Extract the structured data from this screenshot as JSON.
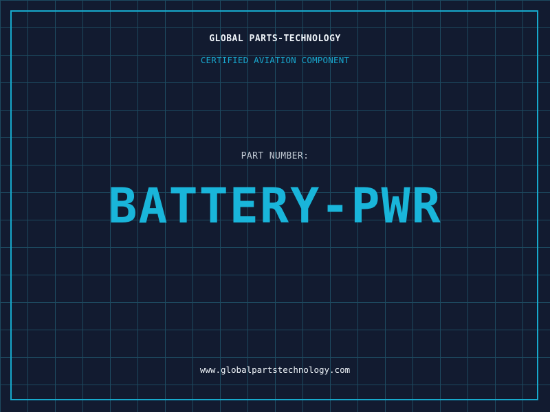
{
  "header": {
    "company_name": "GLOBAL PARTS-TECHNOLOGY",
    "subtitle": "CERTIFIED AVIATION COMPONENT"
  },
  "part": {
    "label": "PART NUMBER:",
    "number": "BATTERY-PWR"
  },
  "footer": {
    "website": "www.globalpartstechnology.com"
  },
  "colors": {
    "background": "#121b30",
    "grid": "#1d4a60",
    "accent": "#18a8cf",
    "text": "#eef3f8"
  }
}
